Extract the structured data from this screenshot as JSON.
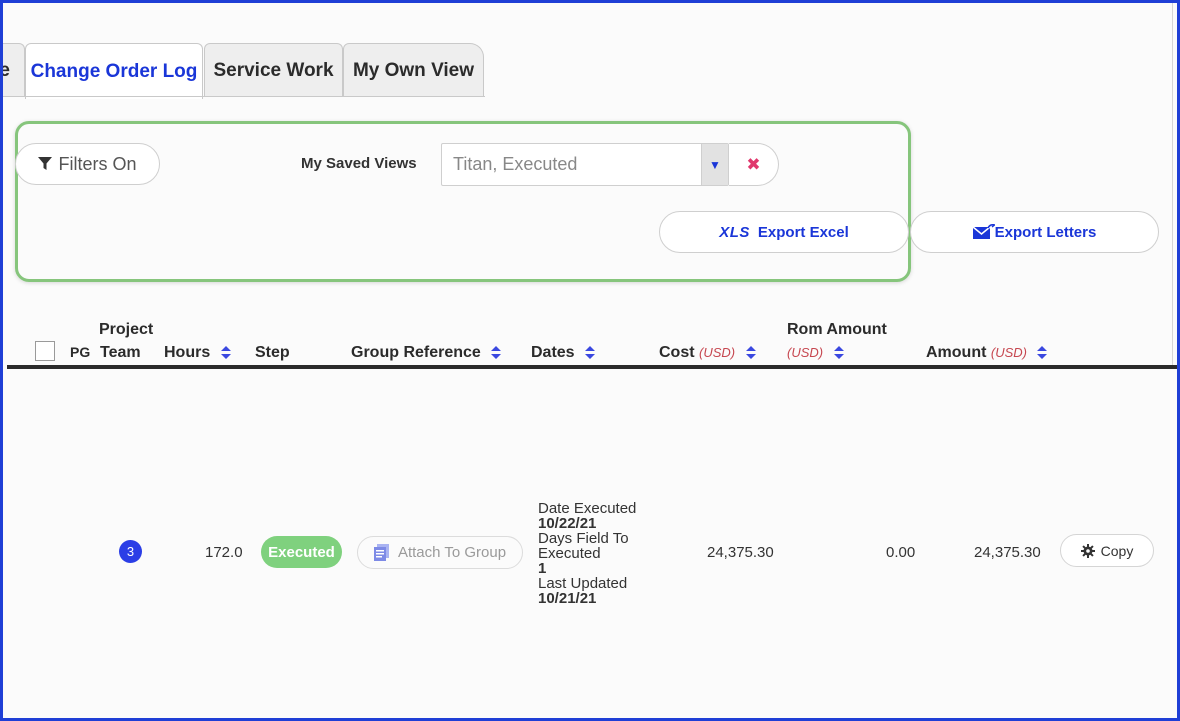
{
  "tabs": [
    {
      "label": "e"
    },
    {
      "label": "Change Order Log"
    },
    {
      "label": "Service Work"
    },
    {
      "label": "My Own View"
    }
  ],
  "filters": {
    "filters_button": "Filters On",
    "saved_views_label": "My Saved Views",
    "saved_views_value": "Titan, Executed",
    "export_excel": "Export Excel",
    "export_excel_icon_text": "XLS",
    "export_letters": "Export Letters"
  },
  "table": {
    "columns": {
      "pg": "PG",
      "project_team_line1": "Project",
      "project_team_line2": "Team",
      "hours": "Hours",
      "step": "Step",
      "group_reference": "Group Reference",
      "dates": "Dates",
      "cost": "Cost",
      "rom_amount": "Rom Amount",
      "amount": "Amount",
      "currency": "(USD)"
    },
    "rows": [
      {
        "team_count": "3",
        "hours": "172.0",
        "step": "Executed",
        "group_action": "Attach To Group",
        "date_executed_label": "Date Executed",
        "date_executed": "10/22/21",
        "days_label_line1": "Days Field To",
        "days_label_line2": "Executed",
        "days_value": "1",
        "last_updated_label": "Last Updated",
        "last_updated": "10/21/21",
        "cost": "24,375.30",
        "rom_amount": "0.00",
        "amount": "24,375.30",
        "action": "Copy"
      }
    ]
  },
  "colors": {
    "accent": "#1a36d8",
    "panel_border": "#86c57c",
    "executed_badge": "#7fd17e",
    "team_badge": "#2b3ee6",
    "currency_text": "#c6464f"
  }
}
